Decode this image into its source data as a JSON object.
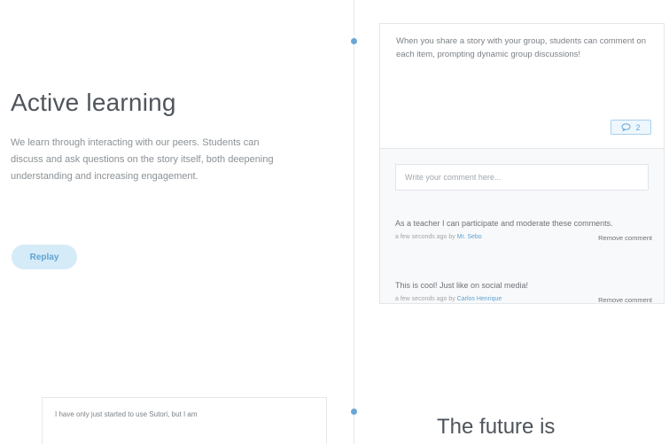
{
  "active_learning": {
    "title": "Active learning",
    "body": "We learn through interacting with our peers. Students can discuss and ask questions on the story itself, both deepening understanding and increasing engagement.",
    "reply_label": "Replay"
  },
  "story_card": {
    "text": "When you share a story with your group, students can comment on each item, prompting dynamic group discussions!",
    "comment_count": "2",
    "comment_icon": "speech-bubble-icon",
    "input_placeholder": "Write your comment here...",
    "remove_label": "Remove comment",
    "comments": [
      {
        "text": "As a teacher I can participate and moderate these comments.",
        "time_prefix": "a few seconds ago by",
        "author": "Mr. Sebo"
      },
      {
        "text": "This is cool! Just like on social media!",
        "time_prefix": "a few seconds ago by",
        "author": "Carlos Henrique"
      }
    ]
  },
  "testimonial": {
    "text": "I have only just started to use Sutori, but I am"
  },
  "next_section": {
    "title": "The future is"
  },
  "colors": {
    "accent": "#6aa6d6",
    "button_bg": "#d6ebf8",
    "timeline": "#dfeaf2"
  }
}
